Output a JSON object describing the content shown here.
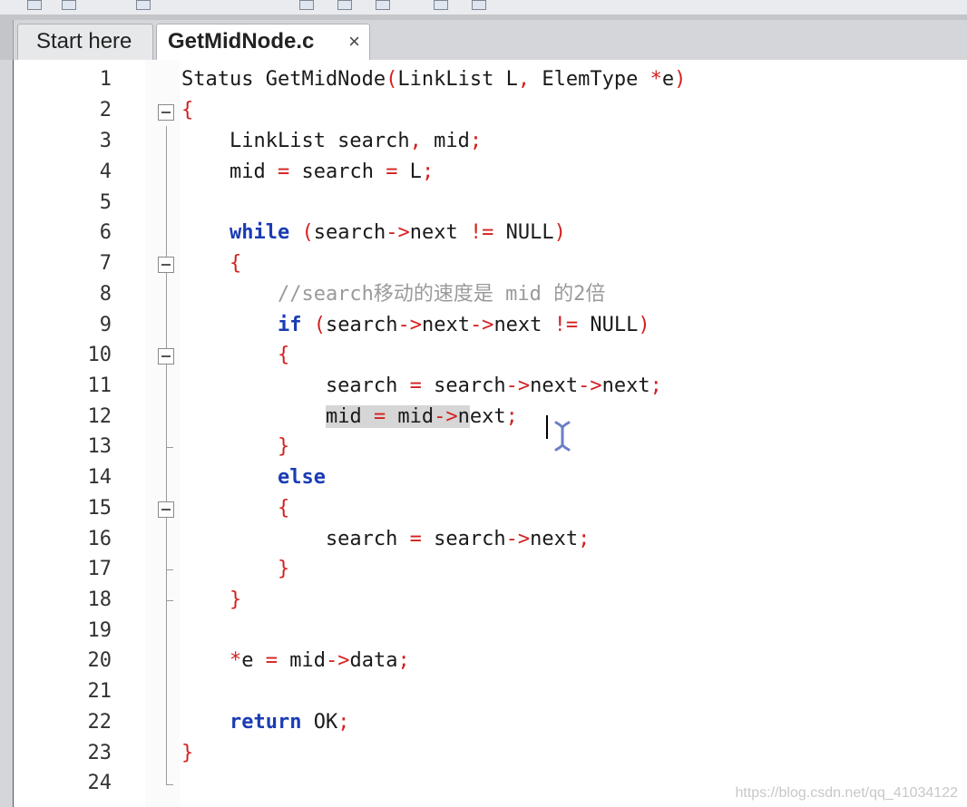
{
  "tabs": [
    {
      "label": "Start here"
    },
    {
      "label": "GetMidNode.c",
      "close": "×"
    }
  ],
  "lines": [
    {
      "n": "1"
    },
    {
      "n": "2"
    },
    {
      "n": "3"
    },
    {
      "n": "4"
    },
    {
      "n": "5"
    },
    {
      "n": "6"
    },
    {
      "n": "7"
    },
    {
      "n": "8"
    },
    {
      "n": "9"
    },
    {
      "n": "10"
    },
    {
      "n": "11"
    },
    {
      "n": "12"
    },
    {
      "n": "13"
    },
    {
      "n": "14"
    },
    {
      "n": "15"
    },
    {
      "n": "16"
    },
    {
      "n": "17"
    },
    {
      "n": "18"
    },
    {
      "n": "19"
    },
    {
      "n": "20"
    },
    {
      "n": "21"
    },
    {
      "n": "22"
    },
    {
      "n": "23"
    },
    {
      "n": "24"
    }
  ],
  "code": {
    "l1_a": "Status GetMidNode",
    "l1_b": "(",
    "l1_c": "LinkList L",
    "l1_d": ",",
    "l1_e": " ElemType ",
    "l1_f": "*",
    "l1_g": "e",
    "l1_h": ")",
    "l2": "{",
    "l3_a": "    LinkList search",
    "l3_b": ",",
    "l3_c": " mid",
    "l3_d": ";",
    "l4_a": "    mid ",
    "l4_b": "=",
    "l4_c": " search ",
    "l4_d": "=",
    "l4_e": " L",
    "l4_f": ";",
    "l6_ind": "    ",
    "l6_kw": "while",
    "l6_a": " ",
    "l6_b": "(",
    "l6_c": "search",
    "l6_d": "->",
    "l6_e": "next ",
    "l6_f": "!=",
    "l6_g": " NULL",
    "l6_h": ")",
    "l7": "    {",
    "l8": "        //search移动的速度是 mid 的2倍",
    "l9_ind": "        ",
    "l9_kw": "if",
    "l9_a": " ",
    "l9_b": "(",
    "l9_c": "search",
    "l9_d": "->",
    "l9_e": "next",
    "l9_f": "->",
    "l9_g": "next ",
    "l9_h": "!=",
    "l9_i": " NULL",
    "l9_j": ")",
    "l10": "        {",
    "l11_a": "            search ",
    "l11_b": "=",
    "l11_c": " search",
    "l11_d": "->",
    "l11_e": "next",
    "l11_f": "->",
    "l11_g": "next",
    "l11_h": ";",
    "l12_ind": "            ",
    "l12_a": "mid ",
    "l12_b": "=",
    "l12_c": " mid",
    "l12_d": "->",
    "l12_e": "n",
    "l12_f": "ext",
    "l12_g": ";",
    "l13": "        }",
    "l14_ind": "        ",
    "l14_kw": "else",
    "l15": "        {",
    "l16_a": "            search ",
    "l16_b": "=",
    "l16_c": " search",
    "l16_d": "->",
    "l16_e": "next",
    "l16_f": ";",
    "l17": "        }",
    "l18": "    }",
    "l20_ind": "    ",
    "l20_a": "*",
    "l20_b": "e ",
    "l20_c": "=",
    "l20_d": " mid",
    "l20_e": "->",
    "l20_f": "data",
    "l20_g": ";",
    "l22_ind": "    ",
    "l22_kw": "return",
    "l22_a": " OK",
    "l22_b": ";",
    "l23": "}"
  },
  "watermark": "https://blog.csdn.net/qq_41034122",
  "colors": {
    "keyword": "#1a3cb4",
    "operator": "#d41f1f",
    "comment": "#9a9a9a",
    "selection": "#d6d6d6"
  },
  "icons": [
    "fold-collapse-icon",
    "text-cursor-icon"
  ]
}
